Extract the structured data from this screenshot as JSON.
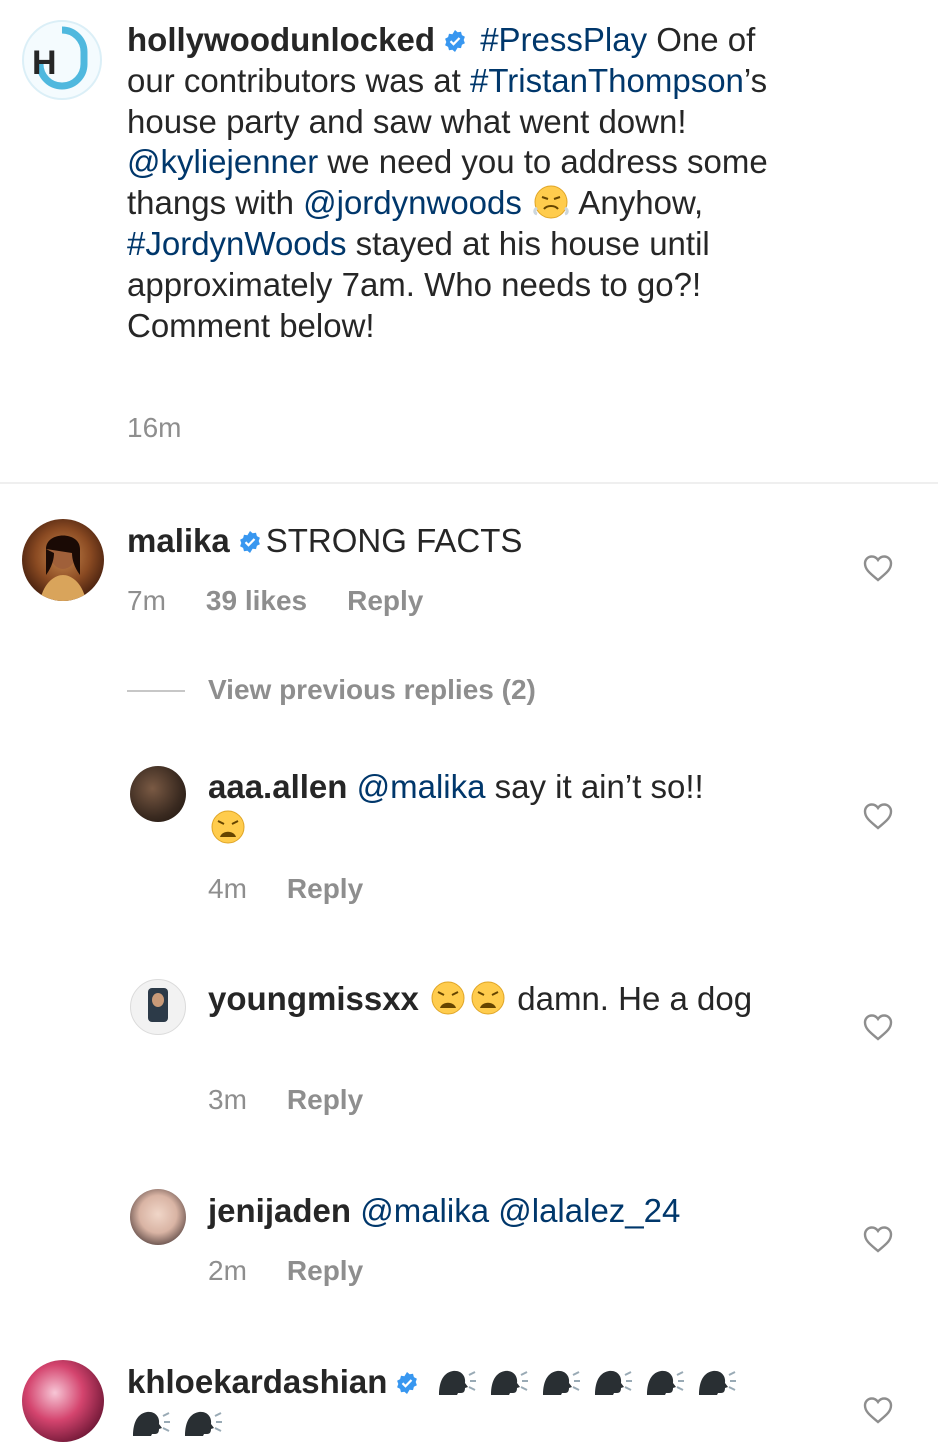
{
  "post": {
    "author": "hollywoodunlocked",
    "caption": {
      "t1": "#PressPlay",
      "t2": " One of our contributors was at ",
      "t3": "#TristanThompson",
      "t4": "’s house party and saw what went down! ",
      "t5": "@kyliejenner",
      "t6": " we need you to address some thangs with ",
      "t7": "@jordynwoods",
      "t8": " Anyhow, ",
      "t9": "#JordynWoods",
      "t10": " stayed at his house until approximately 7am. Who needs to go?! Comment below!"
    },
    "time": "16m",
    "logo_letter": "H"
  },
  "comments": {
    "malika": {
      "username": "malika",
      "text": "STRONG FACTS",
      "time": "7m",
      "likes": "39 likes",
      "reply": "Reply"
    },
    "view_previous": "View previous replies (2)",
    "aaa_allen": {
      "username": "aaa.allen",
      "mention": "@malika",
      "text": " say it ain’t so!!",
      "time": "4m",
      "reply": "Reply"
    },
    "youngmissxx": {
      "username": "youngmissxx",
      "text": " damn. He a dog",
      "time": "3m",
      "reply": "Reply"
    },
    "jenijaden": {
      "username": "jenijaden",
      "mention1": "@malika",
      "mention2": "@lalalez_24",
      "time": "2m",
      "reply": "Reply"
    },
    "khloekardashian": {
      "username": "khloekardashian"
    }
  },
  "colors": {
    "link": "#00376b",
    "verified": "#3897f0",
    "muted": "#8e8e8e",
    "logo": "#4fb8de"
  },
  "icons": [
    "verified-badge-icon",
    "heart-outline-icon",
    "weary-face-emoji",
    "steaming-face-emoji",
    "speaking-head-emoji"
  ]
}
